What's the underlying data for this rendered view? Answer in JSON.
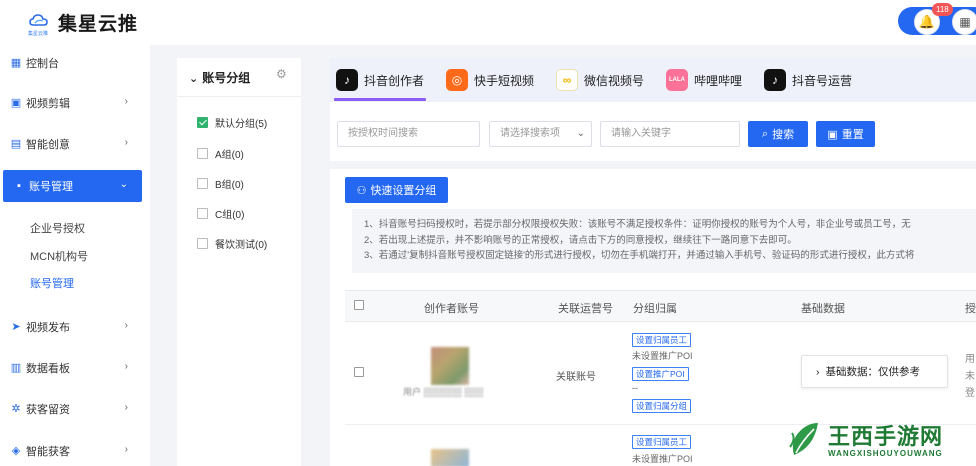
{
  "app": {
    "title": "集星云推",
    "logo_subtext": "集星云推"
  },
  "topbar": {
    "notification_count": "118"
  },
  "sidebar": {
    "items": [
      {
        "label": "控制台",
        "icon": "dashboard-icon"
      },
      {
        "label": "视频剪辑",
        "icon": "video-edit-icon"
      },
      {
        "label": "智能创意",
        "icon": "smart-creative-icon"
      },
      {
        "label": "账号管理",
        "icon": "account-icon"
      },
      {
        "label": "视频发布",
        "icon": "send-icon"
      },
      {
        "label": "数据看板",
        "icon": "chart-icon"
      },
      {
        "label": "获客留资",
        "icon": "customer-icon"
      },
      {
        "label": "智能获客",
        "icon": "smart-customer-icon"
      }
    ],
    "subitems": [
      "企业号授权",
      "MCN机构号",
      "账号管理"
    ]
  },
  "groups": {
    "title": "账号分组",
    "items": [
      {
        "label": "默认分组(5)",
        "checked": true
      },
      {
        "label": "A组(0)",
        "checked": false
      },
      {
        "label": "B组(0)",
        "checked": false
      },
      {
        "label": "C组(0)",
        "checked": false
      },
      {
        "label": "餐饮测试(0)",
        "checked": false
      }
    ]
  },
  "tabs": [
    {
      "label": "抖音创作者",
      "color": "#111111"
    },
    {
      "label": "快手短视频",
      "color": "#ff6a1a"
    },
    {
      "label": "微信视频号",
      "color": "#f5b400"
    },
    {
      "label": "哔哩哔哩",
      "color": "#fb7299"
    },
    {
      "label": "抖音号运营",
      "color": "#111111"
    }
  ],
  "filters": {
    "time_placeholder": "按授权时间搜索",
    "select_placeholder": "请选择搜索项",
    "keyword_placeholder": "请输入关键字",
    "search_label": "搜索",
    "reset_label": "重置"
  },
  "quick_group_label": "快速设置分组",
  "notice_lines": [
    "1、抖音账号扫码授权时，若提示部分权限授权失败：该账号不满足授权条件：证明你授权的账号为个人号，非企业号或员工号，无",
    "2、若出现上述提示，并不影响账号的正常授权，请点击下方的同意授权，继续往下一路同意下去即可。",
    "3、若通过'复制抖音账号授权固定链接'的形式进行授权，切勿在手机端打开，并通过输入手机号、验证码的形式进行授权，此方式将"
  ],
  "table": {
    "headers": [
      "创作者账号",
      "关联运营号",
      "分组归属",
      "基础数据",
      "授"
    ],
    "rows": [
      {
        "account_text": "用户",
        "linked": "关联账号",
        "group_tags": [
          "设置归属员工",
          "设置推广POI",
          "设置归属分组"
        ],
        "group_texts": [
          "未设置推广POI",
          "--"
        ],
        "basic_label": "基础数据：仅供参考",
        "extra_lines": [
          "用",
          "未",
          "登"
        ]
      },
      {
        "group_tags": [
          "设置归属员工"
        ],
        "group_texts": [
          "未设置推广POI"
        ]
      }
    ]
  },
  "watermark": {
    "title": "王西手游网",
    "subtitle": "WANGXISHOUYOUWANG"
  }
}
